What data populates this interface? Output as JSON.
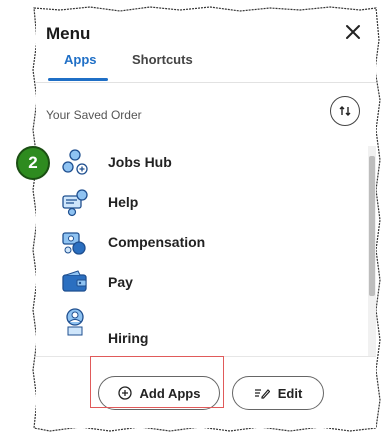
{
  "menu": {
    "title": "Menu",
    "tabs": [
      {
        "label": "Apps",
        "active": true
      },
      {
        "label": "Shortcuts",
        "active": false
      }
    ],
    "saved_order_label": "Your Saved Order",
    "apps": [
      {
        "label": "Jobs Hub",
        "icon": "jobs-hub-icon"
      },
      {
        "label": "Help",
        "icon": "help-icon"
      },
      {
        "label": "Compensation",
        "icon": "compensation-icon"
      },
      {
        "label": "Pay",
        "icon": "pay-icon"
      },
      {
        "label": "Hiring",
        "icon": "hiring-icon"
      }
    ],
    "buttons": {
      "add_apps": "Add Apps",
      "edit": "Edit"
    }
  },
  "callout": {
    "number": "2"
  },
  "colors": {
    "accent": "#1f6fc6",
    "badge": "#2e8b1f",
    "highlight": "#e05a5a"
  }
}
